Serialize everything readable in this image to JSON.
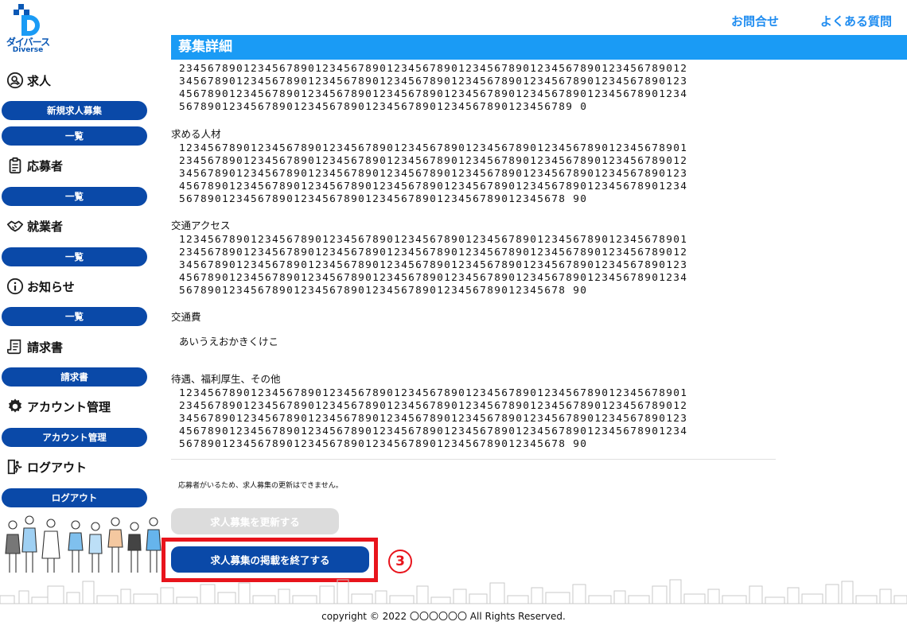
{
  "brand": {
    "name_jp": "ダイバース",
    "name_en": "Diverse"
  },
  "top_links": {
    "contact": "お問合せ",
    "faq": "よくある質問"
  },
  "sidebar": {
    "sections": [
      {
        "icon": "user-search-icon",
        "label": "求人",
        "buttons": [
          "新規求人募集",
          "一覧"
        ]
      },
      {
        "icon": "clipboard-icon",
        "label": "応募者",
        "buttons": [
          "一覧"
        ]
      },
      {
        "icon": "handshake-icon",
        "label": "就業者",
        "buttons": [
          "一覧"
        ]
      },
      {
        "icon": "info-icon",
        "label": "お知らせ",
        "buttons": [
          "一覧"
        ]
      },
      {
        "icon": "invoice-icon",
        "label": "請求書",
        "buttons": [
          "請求書"
        ]
      },
      {
        "icon": "gear-icon",
        "label": "アカウント管理",
        "buttons": [
          "アカウント管理"
        ]
      },
      {
        "icon": "logout-icon",
        "label": "ログアウト",
        "buttons": [
          "ログアウト"
        ]
      }
    ]
  },
  "main": {
    "title": "募集詳細",
    "description_lines": [
      "23456789012345678901234567890123456789012345678901234567890123456789012",
      "34567890123456789012345678901234567890123456789012345678901234567890123",
      "45678901234567890123456789012345678901234567890123456789012345678901234",
      "5678901234567890123456789012345678901234567890123456789 0"
    ],
    "fields": [
      {
        "label": "求める人材",
        "lines": [
          "12345678901234567890123456789012345678901234567890123456789012345678901",
          "23456789012345678901234567890123456789012345678901234567890123456789012",
          "34567890123456789012345678901234567890123456789012345678901234567890123",
          "45678901234567890123456789012345678901234567890123456789012345678901234",
          "567890123456789012345678901234567890123456789012345678 90"
        ]
      },
      {
        "label": "交通アクセス",
        "lines": [
          "12345678901234567890123456789012345678901234567890123456789012345678901",
          "23456789012345678901234567890123456789012345678901234567890123456789012",
          "34567890123456789012345678901234567890123456789012345678901234567890123",
          "45678901234567890123456789012345678901234567890123456789012345678901234",
          "567890123456789012345678901234567890123456789012345678 90"
        ]
      },
      {
        "label": "交通費",
        "value": "あいうえおかきくけこ"
      },
      {
        "label": "待遇、福利厚生、その他",
        "lines": [
          "12345678901234567890123456789012345678901234567890123456789012345678901",
          "23456789012345678901234567890123456789012345678901234567890123456789012",
          "34567890123456789012345678901234567890123456789012345678901234567890123",
          "45678901234567890123456789012345678901234567890123456789012345678901234",
          "567890123456789012345678901234567890123456789012345678 90"
        ]
      }
    ],
    "notice": "応募者がいるため、求人募集の更新はできません。",
    "update_button": "求人募集を更新する",
    "end_button": "求人募集の掲載を終了する",
    "step_marker": "3"
  },
  "footer": {
    "copyright": "copyright © 2022 〇〇〇〇〇〇 All Rights Reserved."
  },
  "colors": {
    "primary": "#0a49a8",
    "header": "#1a9bf5",
    "link": "#1f8cf0",
    "highlight": "#e8141c"
  }
}
